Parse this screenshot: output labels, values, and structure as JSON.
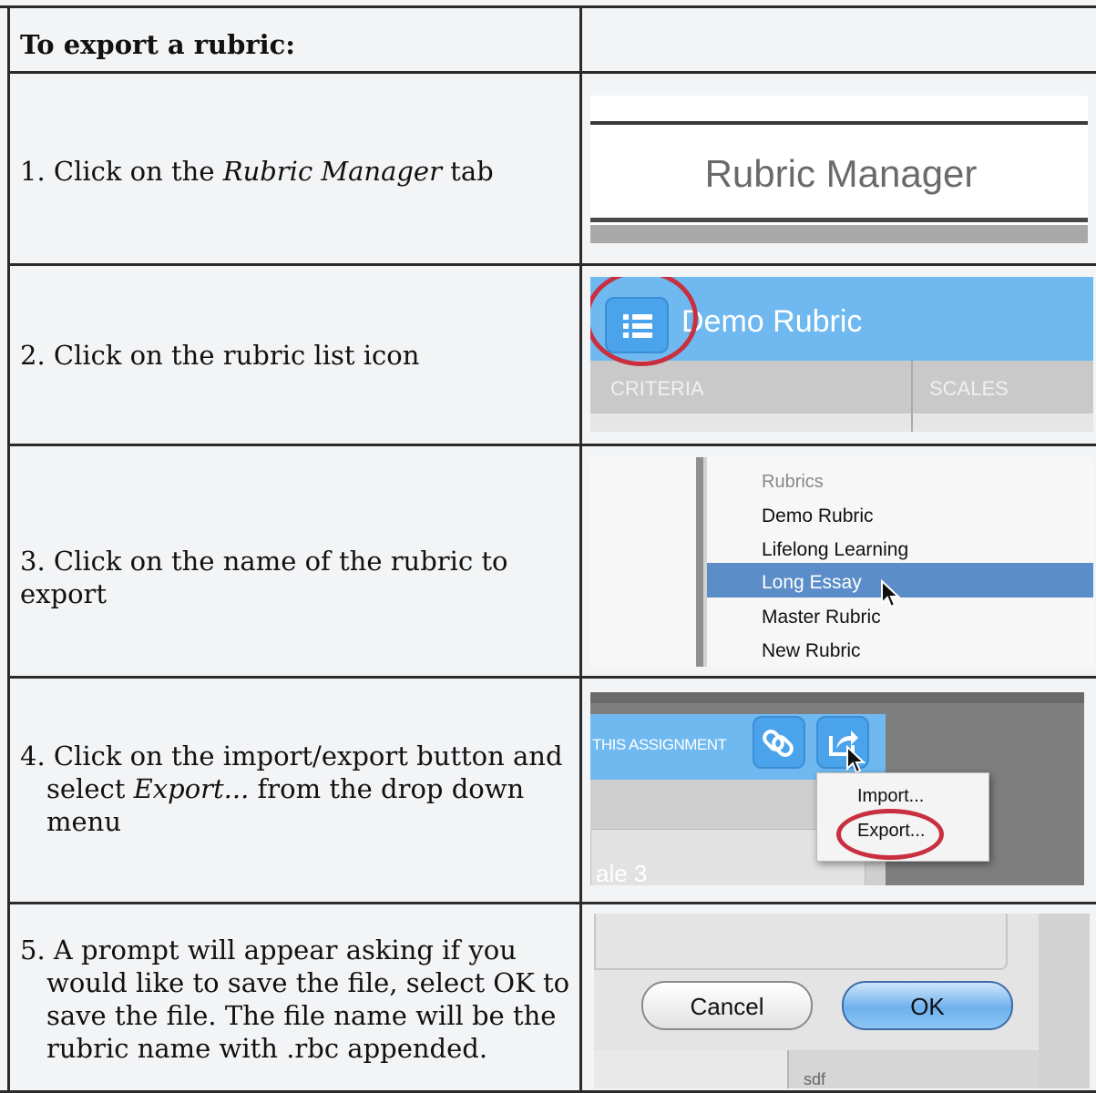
{
  "heading": "To export a rubric:",
  "steps": [
    {
      "number": "1.",
      "pre": "Click on the ",
      "em": "Rubric Manager",
      "post": " tab"
    },
    {
      "number": "2.",
      "text": "Click on the rubric list icon"
    },
    {
      "number": "3.",
      "text": "Click on the name of the rubric to export"
    },
    {
      "number": "4.",
      "pre": "Click on the import/export button and select ",
      "em": "Export...",
      "post": " from the drop down menu"
    },
    {
      "number": "5.",
      "text": "A prompt will appear asking if you would like to save the file, select OK to save the file. The file name will be the rubric name with .rbc appended."
    }
  ],
  "shot1": {
    "tab_label": "Rubric Manager"
  },
  "shot2": {
    "title": "Demo Rubric",
    "col1": "CRITERIA",
    "col2": "SCALES"
  },
  "shot3": {
    "header": "Rubrics",
    "items": [
      "Demo Rubric",
      "Lifelong Learning",
      "Long Essay",
      "Master Rubric",
      "New Rubric"
    ],
    "selected_index": 2
  },
  "shot4": {
    "bar_text": "THIS ASSIGNMENT",
    "menu": [
      "Import...",
      "Export..."
    ],
    "partial_text": "ale 3"
  },
  "shot5": {
    "cancel": "Cancel",
    "ok": "OK",
    "footer": "sdf"
  },
  "colors": {
    "blue": "#6fb9f0",
    "highlight": "#5b8dc9",
    "circle": "#c8303f"
  }
}
